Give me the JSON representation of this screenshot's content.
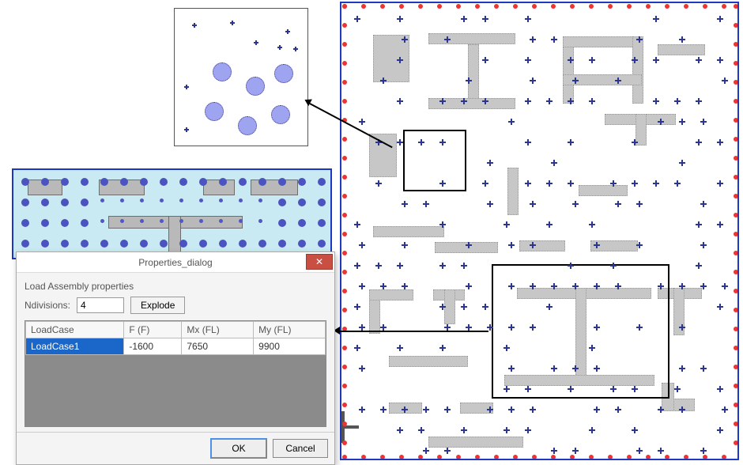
{
  "dialog": {
    "title": "Properties_dialog",
    "legend": "Load Assembly properties",
    "ndiv_label": "Ndivisions:",
    "ndiv_value": "4",
    "explode_label": "Explode",
    "columns": [
      "LoadCase",
      "F (F)",
      "Mx (FL)",
      "My (FL)"
    ],
    "rows": [
      {
        "case": "LoadCase1",
        "F": "-1600",
        "Mx": "7650",
        "My": "9900"
      }
    ],
    "ok": "OK",
    "cancel": "Cancel",
    "close_glyph": "✕"
  },
  "icons": {
    "arrow_to_zoom": "callout-arrow",
    "arrow_to_dialog": "callout-arrow"
  },
  "colors": {
    "plan_border": "#2039c1",
    "edge_dot": "#e33",
    "mark": "#2c3590",
    "wall": "#c7c7c7",
    "slab_bg": "#c9eaf2",
    "dialog_close": "#c94f42",
    "row_select": "#1a66c9"
  }
}
